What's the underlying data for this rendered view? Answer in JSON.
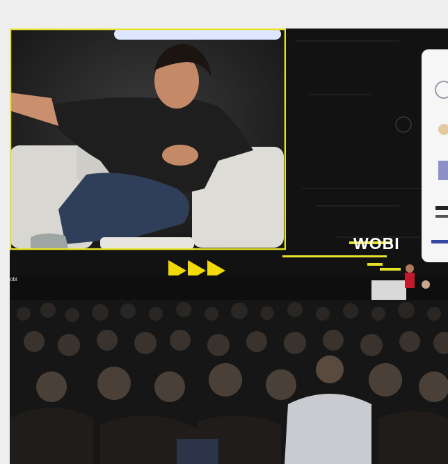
{
  "image": {
    "description_tag": "conference-stage-photo",
    "colors": {
      "page_background": "#eeeeee",
      "screen_border": "#e8e22a",
      "arrow_color": "#f1d90a",
      "stage_dark": "#151515"
    }
  },
  "stage_screen": {
    "brand_logo_text": "WOBI",
    "corner_text": "obi"
  }
}
